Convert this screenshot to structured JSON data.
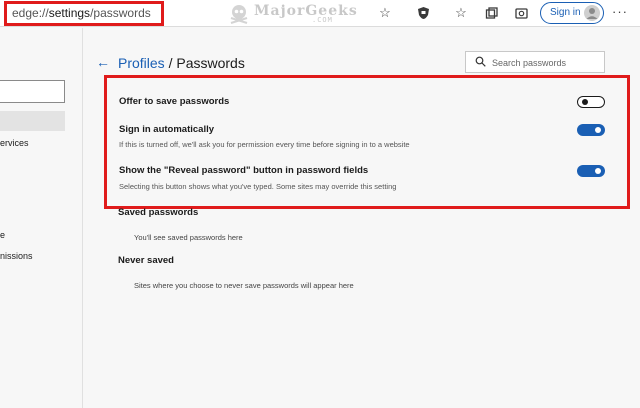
{
  "toolbar": {
    "address_prefix": "edge://",
    "address_strong": "settings",
    "address_suffix": "/passwords",
    "watermark": "MajorGeeks",
    "watermark_sub": ".COM",
    "signin_label": "Sign in",
    "more_label": "···"
  },
  "sidebar": {
    "items": [
      {
        "label": "ervices"
      },
      {
        "label": "e"
      },
      {
        "label": "nissions"
      }
    ]
  },
  "header": {
    "back_label": "←",
    "crumb_profiles": "Profiles",
    "crumb_sep": " / ",
    "crumb_current": "Passwords",
    "search_placeholder": "Search passwords"
  },
  "settings": [
    {
      "title": "Offer to save passwords",
      "desc": "",
      "enabled": false
    },
    {
      "title": "Sign in automatically",
      "desc": "If this is turned off, we'll ask you for permission every time before signing in to a website",
      "enabled": true
    },
    {
      "title": "Show the \"Reveal password\" button in password fields",
      "desc": "Selecting this button shows what you've typed. Some sites may override this setting",
      "enabled": true
    }
  ],
  "sections": {
    "saved_title": "Saved passwords",
    "saved_desc": "You'll see saved passwords here",
    "never_title": "Never saved",
    "never_desc": "Sites where you choose to never save passwords will appear here"
  },
  "colors": {
    "accent": "#1a5fb4",
    "highlight": "#e01b1b"
  }
}
